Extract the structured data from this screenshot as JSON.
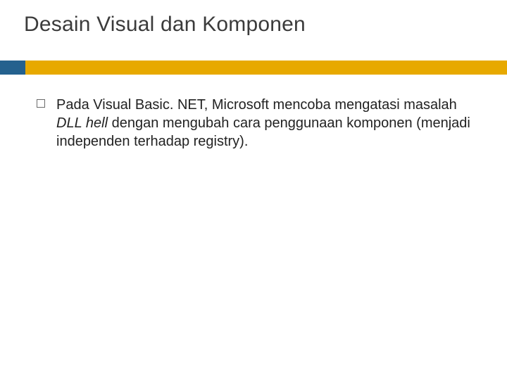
{
  "slide": {
    "title": "Desain Visual dan Komponen",
    "accent_color": "#e7a900",
    "block_color": "#24618e",
    "bullets": [
      {
        "before": "Pada Visual Basic. NET, Microsoft mencoba mengatasi masalah ",
        "italic": "DLL hell",
        "after": " dengan mengubah cara penggunaan komponen (menjadi independen terhadap registry)."
      }
    ]
  }
}
